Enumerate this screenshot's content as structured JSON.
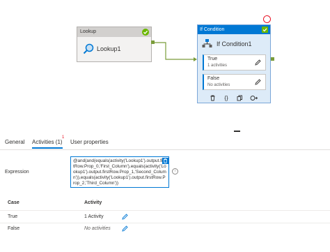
{
  "canvas": {
    "lookup": {
      "header": "Lookup",
      "name": "Lookup1",
      "status_color": "#6bb700"
    },
    "if_condition": {
      "header": "If Condition",
      "name": "If Condition1",
      "true_branch": {
        "label": "True",
        "count": "1 activities"
      },
      "false_branch": {
        "label": "False",
        "count": "No activities"
      }
    }
  },
  "tabs": {
    "general": "General",
    "activities": "Activities (1)",
    "activities_badge": "1",
    "user_properties": "User properties"
  },
  "expression": {
    "label": "Expression",
    "value": "@and(and(equals(activity('Lookup1').output.firstRow.Prop_0,'First_Column'),equals(activity('Lookup1').output.firstRow.Prop_1,'Second_Column')),equals(activity('Lookup1').output.firstRow.Prop_2,'Third_Column'))"
  },
  "table": {
    "headers": {
      "case": "Case",
      "activity": "Activity"
    },
    "rows": [
      {
        "case": "True",
        "activity": "1 Activity"
      },
      {
        "case": "False",
        "activity": "No activities"
      }
    ]
  },
  "colors": {
    "accent": "#0078d4",
    "success": "#6bb700",
    "error": "#e81123"
  }
}
